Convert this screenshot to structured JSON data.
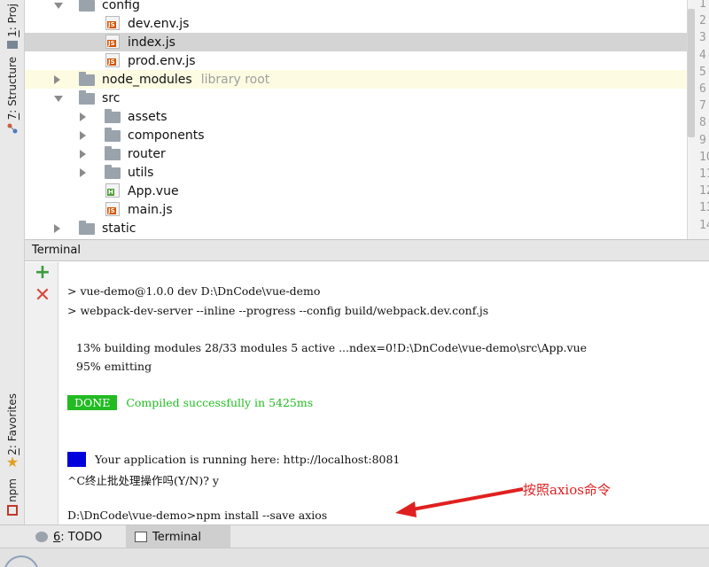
{
  "side_tabs": {
    "project": {
      "num": "1",
      "label": ": Proj"
    },
    "structure": {
      "num": "7",
      "label": ": Structure"
    },
    "favorites": {
      "num": "2",
      "label": ": Favorites"
    },
    "npm": {
      "label": "npm"
    }
  },
  "tree": {
    "items": [
      {
        "name": "config",
        "type": "folder",
        "expanded": true
      },
      {
        "name": "dev.env.js",
        "type": "js"
      },
      {
        "name": "index.js",
        "type": "js",
        "selected": true
      },
      {
        "name": "prod.env.js",
        "type": "js"
      },
      {
        "name": "node_modules",
        "type": "folder",
        "expanded": false,
        "hint": "library root"
      },
      {
        "name": "src",
        "type": "folder",
        "expanded": true
      },
      {
        "name": "assets",
        "type": "folder",
        "expanded": false
      },
      {
        "name": "components",
        "type": "folder",
        "expanded": false
      },
      {
        "name": "router",
        "type": "folder",
        "expanded": false
      },
      {
        "name": "utils",
        "type": "folder",
        "expanded": false
      },
      {
        "name": "App.vue",
        "type": "vue"
      },
      {
        "name": "main.js",
        "type": "js"
      },
      {
        "name": "static",
        "type": "folder",
        "expanded": false
      }
    ]
  },
  "gutter": {
    "line_numbers": [
      "1",
      "2",
      "3",
      "4",
      "5",
      "6",
      "7",
      "8",
      "9",
      "10",
      "11",
      "12",
      "13",
      "14"
    ]
  },
  "terminal": {
    "title": "Terminal",
    "lines": {
      "cmd1": "> vue-demo@1.0.0 dev D:\\DnCode\\vue-demo",
      "cmd2": "> webpack-dev-server --inline --progress --config build/webpack.dev.conf.js",
      "progress": "13% building modules 28/33 modules 5 active ...ndex=0!D:\\DnCode\\vue-demo\\src\\App.vue",
      "emitting": "95% emitting",
      "done_badge": "DONE",
      "done_text": "Compiled successfully in 5425ms",
      "info_badge": "I",
      "running": "Your application is running here: http://localhost:8081",
      "batch": "^C终止批处理操作吗(Y/N)? y",
      "install": "D:\\DnCode\\vue-demo>npm install --save axios"
    },
    "annotation": "按照axios命令"
  },
  "bottom_bar": {
    "todo": {
      "num": "6",
      "label": ": TODO"
    },
    "terminal": {
      "label": "Terminal"
    }
  },
  "colors": {
    "done_green": "#22bb22",
    "info_blue": "#0000dd",
    "annotation_red": "#e02020",
    "selected_row": "#d4d4d4"
  }
}
